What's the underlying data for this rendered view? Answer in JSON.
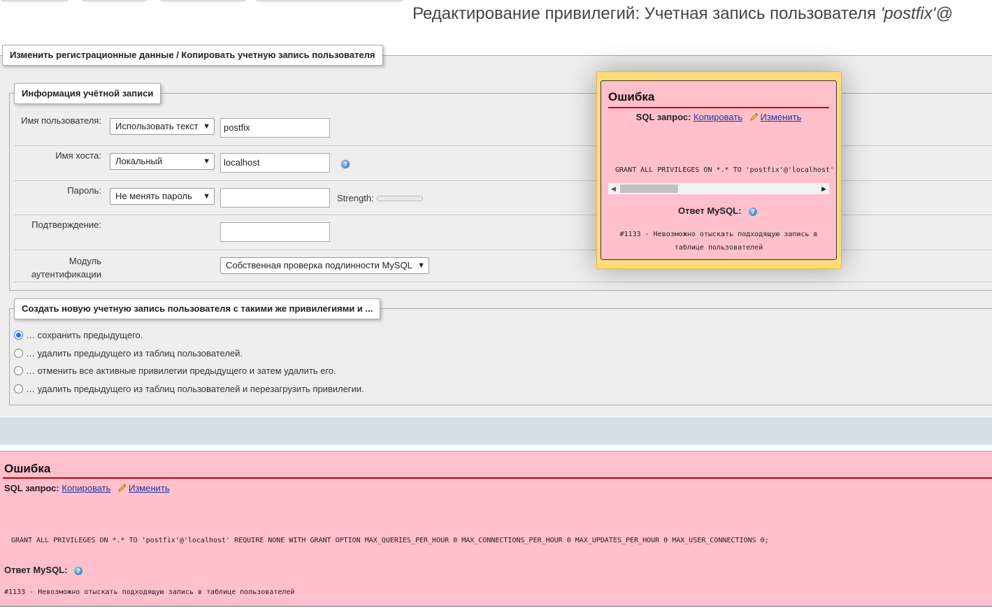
{
  "page": {
    "title_prefix": "Редактирование привилегий: Учетная запись пользователя ",
    "title_user": "'postfix'@"
  },
  "login_section": {
    "legend": "Изменить регистрационные данные / Копировать учетную запись пользователя",
    "account_legend": "Информация учётной записи",
    "username": {
      "label": "Имя пользователя:",
      "select": "Использовать текст",
      "value": "postfix"
    },
    "hostname": {
      "label": "Имя хоста:",
      "select": "Локальный",
      "value": "localhost"
    },
    "password": {
      "label": "Пароль:",
      "select": "Не менять пароль",
      "value": "",
      "strength_label": "Strength:",
      "strength": 0
    },
    "confirm": {
      "label": "Подтверждение:",
      "value": ""
    },
    "auth": {
      "label_line1": "Модуль",
      "label_line2": "аутентификации",
      "select": "Собственная проверка подлинности MySQL"
    }
  },
  "copy_section": {
    "legend": "Создать новую учетную запись пользователя с такими же привилегиями и ...",
    "options": [
      {
        "label": "… сохранить предыдущего.",
        "checked": true
      },
      {
        "label": "… удалить предыдущего из таблиц пользователей.",
        "checked": false
      },
      {
        "label": "… отменить все активные привилегии предыдущего и затем удалить его.",
        "checked": false
      },
      {
        "label": "… удалить предыдущего из таблиц пользователей и перезагрузить привилегии.",
        "checked": false
      }
    ]
  },
  "popup_error": {
    "title": "Ошибка",
    "sql_label": "SQL запрос:",
    "copy_link": "Копировать",
    "edit_link": "Изменить",
    "sql": "GRANT ALL PRIVILEGES ON *.* TO 'postfix'@'localhost'",
    "response_label": "Ответ MySQL:",
    "message_line1": "#1133 - Невозможно отыскать подходящую запись в",
    "message_line2": "таблице пользователей"
  },
  "bottom_error": {
    "title": "Ошибка",
    "sql_label": "SQL запрос:",
    "copy_link": "Копировать",
    "edit_link": "Изменить",
    "sql": "GRANT ALL PRIVILEGES ON *.* TO 'postfix'@'localhost' REQUIRE NONE WITH GRANT OPTION MAX_QUERIES_PER_HOUR 0 MAX_CONNECTIONS_PER_HOUR 0 MAX_UPDATES_PER_HOUR 0 MAX_USER_CONNECTIONS 0;",
    "response_label": "Ответ MySQL:",
    "message": "#1133 - Невозможно отыскать подходящую запись в таблице пользователей"
  },
  "icons": {
    "help": "help-icon",
    "edit": "pencil-icon",
    "select_arrow": "chevron-down-icon"
  }
}
